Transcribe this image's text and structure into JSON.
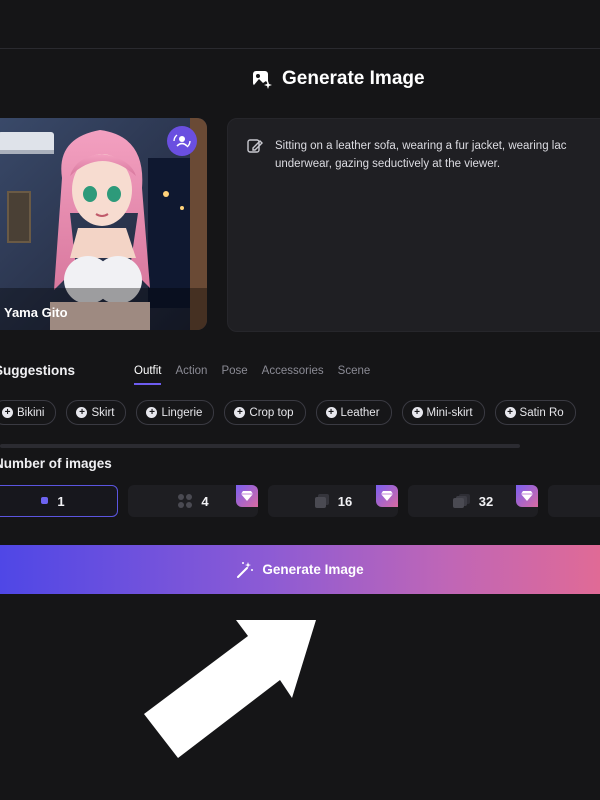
{
  "header": {
    "title": "Generate Image"
  },
  "character": {
    "name": "Yama Gito"
  },
  "prompt": {
    "text": "Sitting on a leather sofa, wearing a fur jacket, wearing lac underwear, gazing seductively at the viewer."
  },
  "suggestions": {
    "label": "Suggestions",
    "tabs": [
      "Outfit",
      "Action",
      "Pose",
      "Accessories",
      "Scene"
    ],
    "active_tab": "Outfit",
    "chips": [
      "Bikini",
      "Skirt",
      "Lingerie",
      "Crop top",
      "Leather",
      "Mini-skirt",
      "Satin Ro"
    ]
  },
  "images": {
    "label": "Number of images",
    "options": [
      "1",
      "4",
      "16",
      "32"
    ],
    "selected": "1"
  },
  "generate_button": {
    "label": "Generate Image"
  },
  "colors": {
    "accent": "#6d5cf0",
    "button_gradient_start": "#4f47e6",
    "button_gradient_end": "#e06a96",
    "background": "#151517"
  }
}
